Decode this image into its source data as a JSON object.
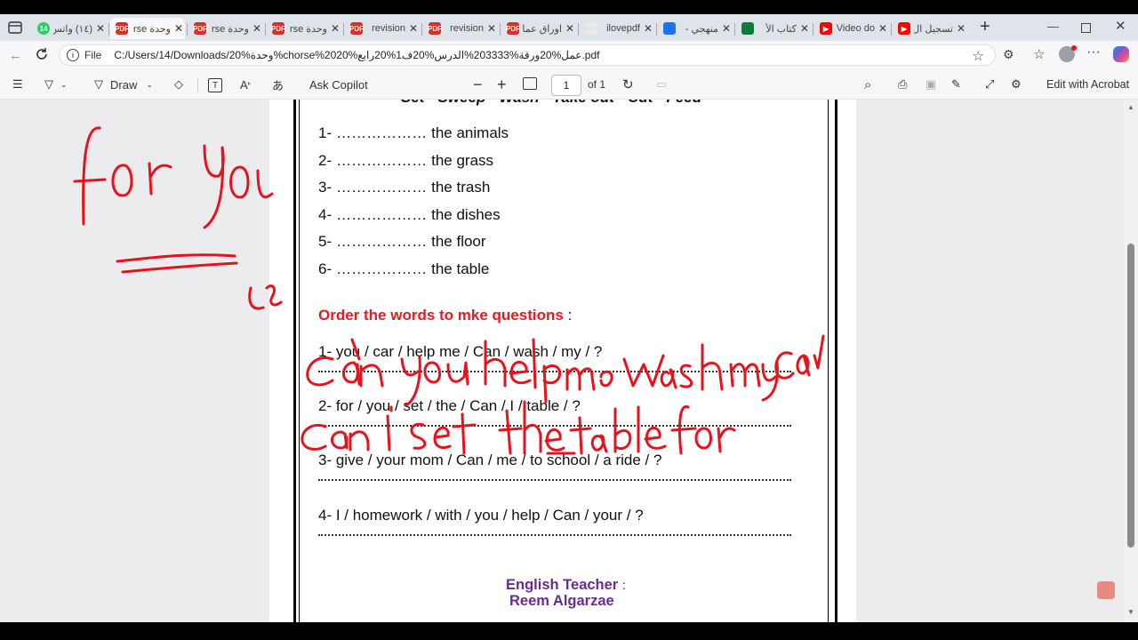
{
  "tabs": [
    {
      "title": "(١٤) واتس",
      "badge": "14",
      "fav_color": "#25d366"
    },
    {
      "title": "وحدة rse",
      "fav_color": "#d93025",
      "fav_text": "PDF",
      "active": true
    },
    {
      "title": "وحدة rse",
      "fav_color": "#d93025",
      "fav_text": "PDF"
    },
    {
      "title": "وحدة rse",
      "fav_color": "#d93025",
      "fav_text": "PDF"
    },
    {
      "title": "revision",
      "fav_color": "#d93025",
      "fav_text": "PDF"
    },
    {
      "title": "revision",
      "fav_color": "#d93025",
      "fav_text": "PDF"
    },
    {
      "title": "اوراق عما",
      "fav_color": "#d93025",
      "fav_text": "PDF"
    },
    {
      "title": "ilovepdf",
      "fav_color": "#e8e8e8",
      "fav_text": ""
    },
    {
      "title": "منهجي -",
      "fav_color": "#1a73e8",
      "fav_text": ""
    },
    {
      "title": "كتاب الأ",
      "fav_color": "#0f7a3a",
      "fav_text": ""
    },
    {
      "title": "Video do",
      "fav_color": "#ff0000",
      "fav_text": "▶"
    },
    {
      "title": "تسجيل ال",
      "fav_color": "#ff0000",
      "fav_text": "▶"
    }
  ],
  "address": {
    "file_label": "File",
    "url": "C:/Users/14/Downloads/20%وحدة%chorse%2020%عمل%20ورقة%203333%الدرس%20ف1%20رابع.pdf"
  },
  "pdf_toolbar": {
    "draw_label": "Draw",
    "copilot_label": "Ask Copilot",
    "page_value": "1",
    "page_of": "of 1",
    "edit_acrobat": "Edit with Acrobat"
  },
  "document": {
    "word_bank": "Set - Sweep - Wash - Take out - Cut - Feed",
    "fill_items": [
      {
        "num": "1-",
        "text": "the animals"
      },
      {
        "num": "2-",
        "text": "the grass"
      },
      {
        "num": "3-",
        "text": "the trash"
      },
      {
        "num": "4-",
        "text": "the dishes"
      },
      {
        "num": "5-",
        "text": "the floor"
      },
      {
        "num": "6-",
        "text": "the table"
      }
    ],
    "blank": "………………",
    "order_heading": "Order the words to mke questions",
    "order_colon": ":",
    "questions": [
      "1- you / car / help me / Can / wash / my / ?",
      "2- for / you / set / the / Can / I / table / ?",
      "3- give / your mom / Can / me / to school / a ride / ?",
      "4- I / homework / with / you / help / Can / your / ?"
    ],
    "teacher_label": "English Teacher",
    "teacher_colon": ":",
    "teacher_name": "Reem Algarzae"
  },
  "colors": {
    "heading_red": "#e31b23",
    "teacher_purple": "#6a2c91",
    "ink_red": "#e8121c"
  }
}
